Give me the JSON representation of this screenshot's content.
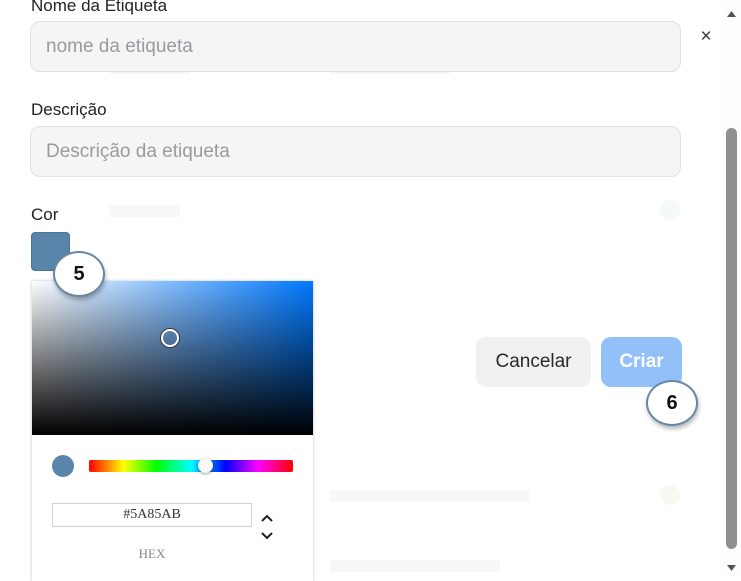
{
  "form": {
    "name_label": "Nome da Etiqueta",
    "name_placeholder": "nome da etiqueta",
    "description_label": "Descrição",
    "description_placeholder": "Descrição da etiqueta",
    "color_label": "Cor",
    "selected_color": "#5A85AB"
  },
  "close_symbol": "×",
  "picker": {
    "hue_color": "#0078ff",
    "hex_value": "#5A85AB",
    "format_label": "HEX"
  },
  "buttons": {
    "cancel": "Cancelar",
    "create": "Criar"
  },
  "annotations": {
    "step_color": "5",
    "step_create": "6"
  }
}
